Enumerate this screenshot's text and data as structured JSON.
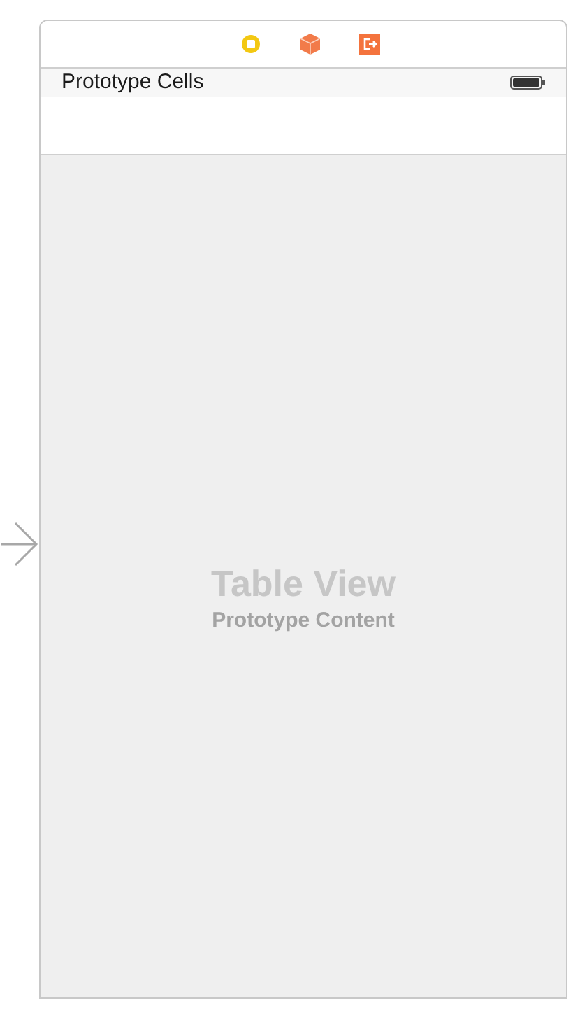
{
  "header": {
    "title": "Prototype Cells"
  },
  "table": {
    "title": "Table View",
    "subtitle": "Prototype Content"
  }
}
